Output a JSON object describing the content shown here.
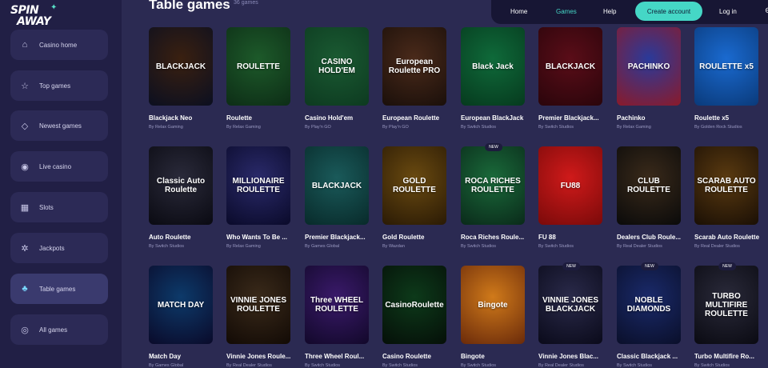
{
  "brand": {
    "line1": "SPIN",
    "line2": "AWAY"
  },
  "sidebar": {
    "items": [
      {
        "label": "Casino home",
        "icon": "home-icon",
        "glyph": "⌂"
      },
      {
        "label": "Top games",
        "icon": "star-circle-icon",
        "glyph": "☆"
      },
      {
        "label": "Newest games",
        "icon": "tag-icon",
        "glyph": "◇"
      },
      {
        "label": "Live casino",
        "icon": "live-icon",
        "glyph": "◉"
      },
      {
        "label": "Slots",
        "icon": "slots-icon",
        "glyph": "▦"
      },
      {
        "label": "Jackpots",
        "icon": "jackpot-icon",
        "glyph": "✲"
      },
      {
        "label": "Table games",
        "icon": "table-games-icon",
        "glyph": "♣",
        "active": true
      },
      {
        "label": "All games",
        "icon": "all-games-icon",
        "glyph": "◎"
      }
    ]
  },
  "header": {
    "title": "Table games",
    "count": "36 games"
  },
  "topnav": {
    "home": "Home",
    "games": "Games",
    "help": "Help",
    "create_account": "Create account",
    "login": "Log in",
    "more_glyph": "⊖"
  },
  "games": [
    {
      "name": "Blackjack Neo",
      "provider": "By Relax Gaming",
      "art": "BLACKJACK",
      "bg": "#3a2010",
      "bg2": "#0b0f20",
      "new": false
    },
    {
      "name": "Roulette",
      "provider": "By Relax Gaming",
      "art": "ROULETTE",
      "bg": "#1d5a2a",
      "bg2": "#0d2d16",
      "new": false
    },
    {
      "name": "Casino Hold'em",
      "provider": "By Play'n GO",
      "art": "CASINO HOLD'EM",
      "bg": "#1a5a32",
      "bg2": "#0d3a20",
      "new": false
    },
    {
      "name": "European Roulette",
      "provider": "By Play'n GO",
      "art": "European Roulette PRO",
      "bg": "#4a2a1a",
      "bg2": "#1a0f0a",
      "new": false
    },
    {
      "name": "European BlackJack",
      "provider": "By Switch Studios",
      "art": "Black Jack",
      "bg": "#0f6a3a",
      "bg2": "#063a1e",
      "new": false
    },
    {
      "name": "Premier Blackjack...",
      "provider": "By Switch Studios",
      "art": "BLACKJACK",
      "bg": "#5a0d18",
      "bg2": "#2a050b",
      "new": false
    },
    {
      "name": "Pachinko",
      "provider": "By Relax Gaming",
      "art": "PACHINKO",
      "bg": "#2a3a9a",
      "bg2": "#8a1a2a",
      "new": false
    },
    {
      "name": "Roulette x5",
      "provider": "By Golden Rock Studios",
      "art": "ROULETTE x5",
      "bg": "#1a6ad0",
      "bg2": "#0a3a7a",
      "new": false
    },
    {
      "name": "Auto Roulette",
      "provider": "By Switch Studios",
      "art": "Classic Auto Roulette",
      "bg": "#2a2a3a",
      "bg2": "#0a0a12",
      "new": false
    },
    {
      "name": "Who Wants To Be ...",
      "provider": "By Relax Gaming",
      "art": "MILLIONAIRE ROULETTE",
      "bg": "#2a2a6a",
      "bg2": "#0a0a2a",
      "new": false
    },
    {
      "name": "Premier Blackjack...",
      "provider": "By Games Global",
      "art": "BLACKJACK",
      "bg": "#1a5a5a",
      "bg2": "#082a2a",
      "new": false
    },
    {
      "name": "Gold Roulette",
      "provider": "By Wazdan",
      "art": "GOLD ROULETTE",
      "bg": "#6a4a10",
      "bg2": "#2a1a05",
      "new": false
    },
    {
      "name": "Roca Riches Roule...",
      "provider": "By Switch Studios",
      "art": "ROCA RICHES ROULETTE",
      "bg": "#1a6a3a",
      "bg2": "#0a2a1a",
      "new": true
    },
    {
      "name": "FU 88",
      "provider": "By Switch Studios",
      "art": "FU88",
      "bg": "#d01a1a",
      "bg2": "#7a0a0a",
      "new": false
    },
    {
      "name": "Dealers Club Roule...",
      "provider": "By Real Dealer Studios",
      "art": "CLUB ROULETTE",
      "bg": "#3a2a1a",
      "bg2": "#0a0a0a",
      "new": false
    },
    {
      "name": "Scarab Auto Roulette",
      "provider": "By Real Dealer Studios",
      "art": "SCARAB AUTO ROULETTE",
      "bg": "#5a3a10",
      "bg2": "#1a0f05",
      "new": false
    },
    {
      "name": "Match Day",
      "provider": "By Games Global",
      "art": "MATCH DAY",
      "bg": "#0d3a6a",
      "bg2": "#0a0a2a",
      "new": false
    },
    {
      "name": "Vinnie Jones Roule...",
      "provider": "By Real Dealer Studios",
      "art": "VINNIE JONES ROULETTE",
      "bg": "#3a2a1a",
      "bg2": "#120a05",
      "new": false
    },
    {
      "name": "Three Wheel Roul...",
      "provider": "By Switch Studios",
      "art": "Three WHEEL ROULETTE",
      "bg": "#3a1a6a",
      "bg2": "#12082a",
      "new": false
    },
    {
      "name": "Casino Roulette",
      "provider": "By Switch Studios",
      "art": "CasinoRoulette",
      "bg": "#0d3a1a",
      "bg2": "#050f08",
      "new": false
    },
    {
      "name": "Bingote",
      "provider": "By Switch Studios",
      "art": "Bingote",
      "bg": "#d07a1a",
      "bg2": "#6a2a0a",
      "new": false
    },
    {
      "name": "Vinnie Jones Blac...",
      "provider": "By Real Dealer Studios",
      "art": "VINNIE JONES BLACKJACK",
      "bg": "#2a2a4a",
      "bg2": "#0a0a1a",
      "new": true
    },
    {
      "name": "Classic Blackjack ...",
      "provider": "By Switch Studios",
      "art": "NOBLE DIAMONDS",
      "bg": "#1a2a6a",
      "bg2": "#0a0f2a",
      "new": true
    },
    {
      "name": "Turbo Multifire Ro...",
      "provider": "By Switch Studios",
      "art": "TURBO MULTIFIRE ROULETTE",
      "bg": "#2a2a3a",
      "bg2": "#0a0a12",
      "new": true
    }
  ],
  "new_badge": "NEW"
}
